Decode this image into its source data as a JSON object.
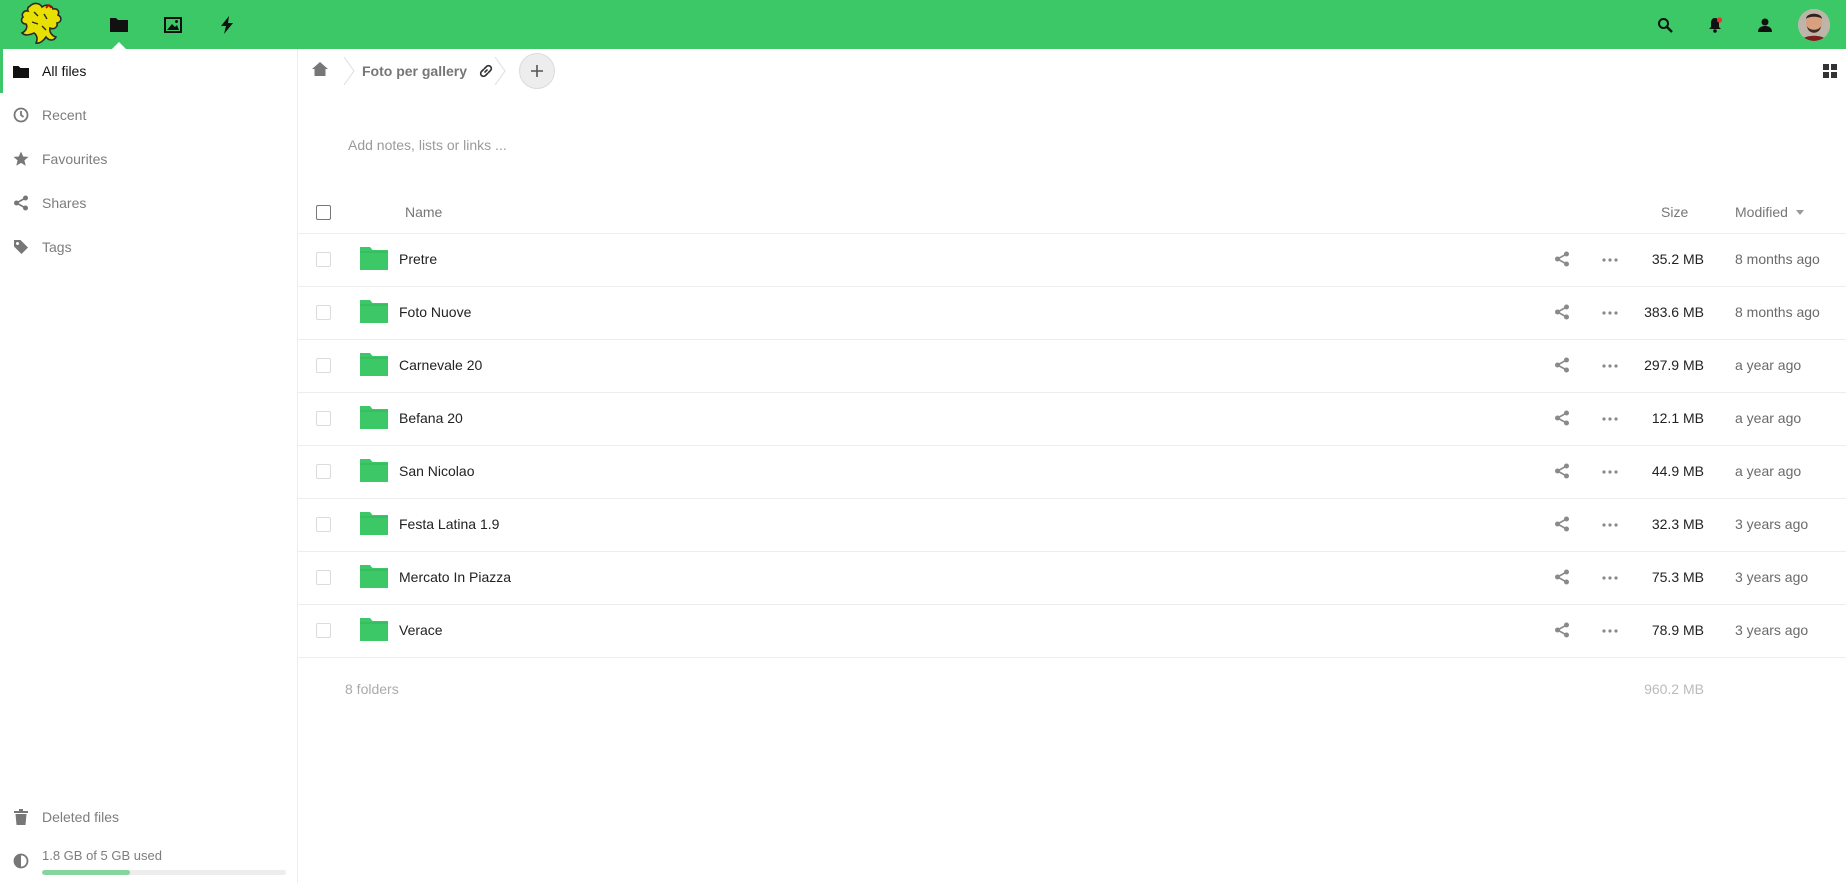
{
  "colors": {
    "brand": "#3cc867",
    "folder": "#3cc867"
  },
  "header": {
    "app_icons": [
      "folder-icon",
      "image-icon",
      "lightning-icon"
    ],
    "right_icons": [
      "search-icon",
      "bell-icon",
      "contacts-icon",
      "avatar"
    ]
  },
  "sidebar": {
    "items": [
      {
        "label": "All files",
        "icon": "folder-icon"
      },
      {
        "label": "Recent",
        "icon": "clock-icon"
      },
      {
        "label": "Favourites",
        "icon": "star-icon"
      },
      {
        "label": "Shares",
        "icon": "share-icon"
      },
      {
        "label": "Tags",
        "icon": "tag-icon"
      }
    ],
    "deleted_label": "Deleted files",
    "quota_label": "1.8 GB of 5 GB used",
    "quota_fraction": 0.36
  },
  "breadcrumb": {
    "folder": "Foto per gallery",
    "add_label": "+"
  },
  "notes_placeholder": "Add notes, lists or links ...",
  "table": {
    "headers": {
      "name": "Name",
      "size": "Size",
      "modified": "Modified"
    },
    "rows": [
      {
        "name": "Pretre",
        "size": "35.2 MB",
        "modified": "8 months ago"
      },
      {
        "name": "Foto Nuove",
        "size": "383.6 MB",
        "modified": "8 months ago"
      },
      {
        "name": "Carnevale 20",
        "size": "297.9 MB",
        "modified": "a year ago"
      },
      {
        "name": "Befana 20",
        "size": "12.1 MB",
        "modified": "a year ago"
      },
      {
        "name": "San Nicolao",
        "size": "44.9 MB",
        "modified": "a year ago"
      },
      {
        "name": "Festa Latina 1.9",
        "size": "32.3 MB",
        "modified": "3 years ago"
      },
      {
        "name": "Mercato In Piazza",
        "size": "75.3 MB",
        "modified": "3 years ago"
      },
      {
        "name": "Verace",
        "size": "78.9 MB",
        "modified": "3 years ago"
      }
    ],
    "summary": {
      "count": "8 folders",
      "total": "960.2 MB"
    }
  }
}
